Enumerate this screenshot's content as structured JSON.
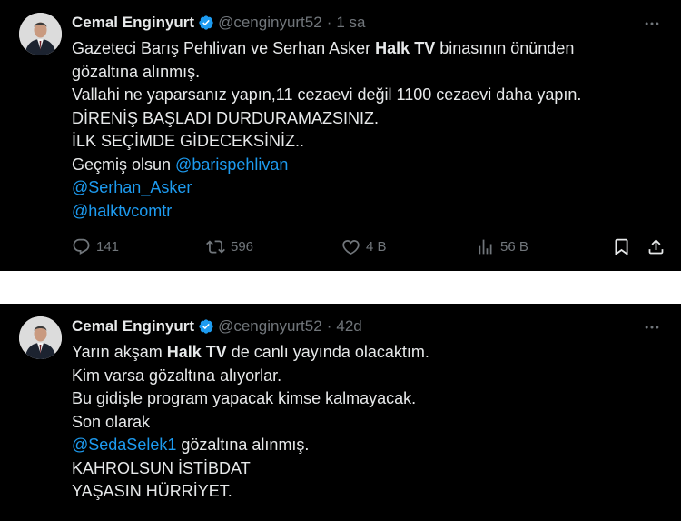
{
  "tweets": [
    {
      "name": "Cemal Enginyurt",
      "handle": "@cenginyurt52",
      "separator": "·",
      "time": "1 sa",
      "lines": {
        "l1_a": "Gazeteci Barış Pehlivan ve Serhan Asker ",
        "l1_b": "Halk TV",
        "l1_c": " binasının önünden",
        "l2": "gözaltına alınmış.",
        "l3": "Vallahi ne yaparsanız yapın,11 cezaevi değil 1100 cezaevi daha yapın.",
        "l4": "DİRENİŞ BAŞLADI DURDURAMAZSINIZ.",
        "l5": "İLK SEÇİMDE GİDECEKSİNİZ..",
        "l6_a": "Geçmiş olsun ",
        "l6_b": "@barispehlivan",
        "l7": "@Serhan_Asker",
        "l8": "@halktvcomtr"
      },
      "stats": {
        "replies": "141",
        "reposts": "596",
        "likes": "4 B",
        "views": "56 B"
      }
    },
    {
      "name": "Cemal Enginyurt",
      "handle": "@cenginyurt52",
      "separator": "·",
      "time": "42d",
      "lines": {
        "l1_a": "Yarın akşam ",
        "l1_b": "Halk TV",
        "l1_c": " de canlı yayında olacaktım.",
        "l2": "Kim varsa gözaltına alıyorlar.",
        "l3": "Bu gidişle program yapacak kimse kalmayacak.",
        "l4": "Son olarak",
        "l5_a": "@SedaSelek1",
        "l5_b": " gözaltına alınmış.",
        "l6": "KAHROLSUN İSTİBDAT",
        "l7": "YAŞASIN HÜRRİYET."
      }
    }
  ],
  "icons": {
    "verified": "verified-badge-icon",
    "more": "more-dots-icon",
    "reply": "reply-icon",
    "repost": "repost-icon",
    "like": "heart-icon",
    "views": "views-icon",
    "bookmark": "bookmark-icon",
    "share": "share-icon"
  },
  "colors": {
    "background": "#000000",
    "text": "#e7e9ea",
    "muted": "#71767b",
    "link": "#1d9bf0",
    "verified": "#1d9bf0"
  }
}
